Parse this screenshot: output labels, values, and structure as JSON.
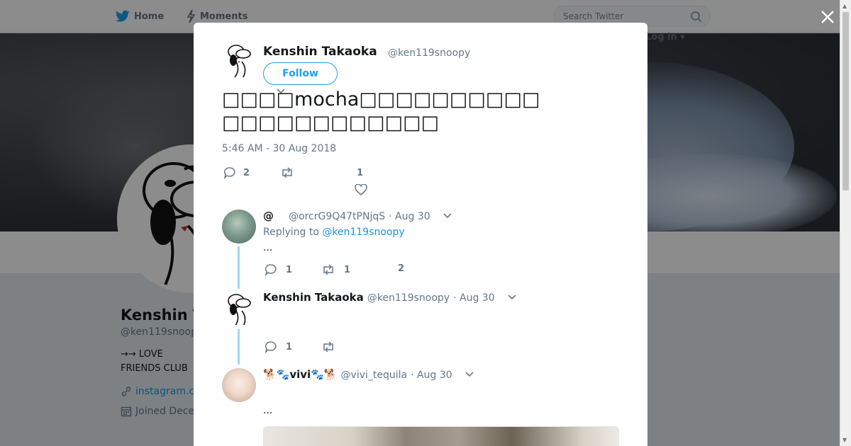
{
  "topbar": {
    "home_label": "Home",
    "moments_label": "Moments",
    "search_placeholder": "Search Twitter",
    "login_label": "Log in"
  },
  "profile": {
    "name": "Kenshin T",
    "handle": "@ken119snoop",
    "bio_line1": "→→  LOVE",
    "bio_line2": "FRIENDS CLUB",
    "url": "instagram.c",
    "joined": "Joined Dece"
  },
  "tweet": {
    "author_name": "Kenshin Takaoka",
    "author_handle": "@ken119snoopy",
    "follow_label": "Follow",
    "text_line1": "□□□□mocha□□□□□□□□□□",
    "text_line2": "□□□□□□□□□□□□",
    "timestamp": "5:46 AM - 30 Aug 2018",
    "reply_count": "2",
    "retweet_count": "",
    "like_count": "1"
  },
  "replies": [
    {
      "name": "@",
      "handle": "@orcrG9Q47tPNjqS",
      "date": "· Aug 30",
      "replying_prefix": "Replying to",
      "replying_to": "@ken119snoopy",
      "text": "...",
      "reply_count": "1",
      "retweet_count": "1",
      "like_count": "2"
    },
    {
      "name": "Kenshin Takaoka",
      "handle": "@ken119snoopy",
      "date": "· Aug 30",
      "text": "",
      "reply_count": "1",
      "retweet_count": "",
      "like_count": ""
    },
    {
      "name": "🐕🐾vivi🐾🐕",
      "handle": "@vivi_tequila",
      "date": "· Aug 30",
      "text": "..."
    }
  ],
  "colors": {
    "accent": "#1da1f2",
    "link": "#1b95e0",
    "text": "#14171a",
    "muted": "#657786",
    "thread_line": "#9fd8f7"
  }
}
